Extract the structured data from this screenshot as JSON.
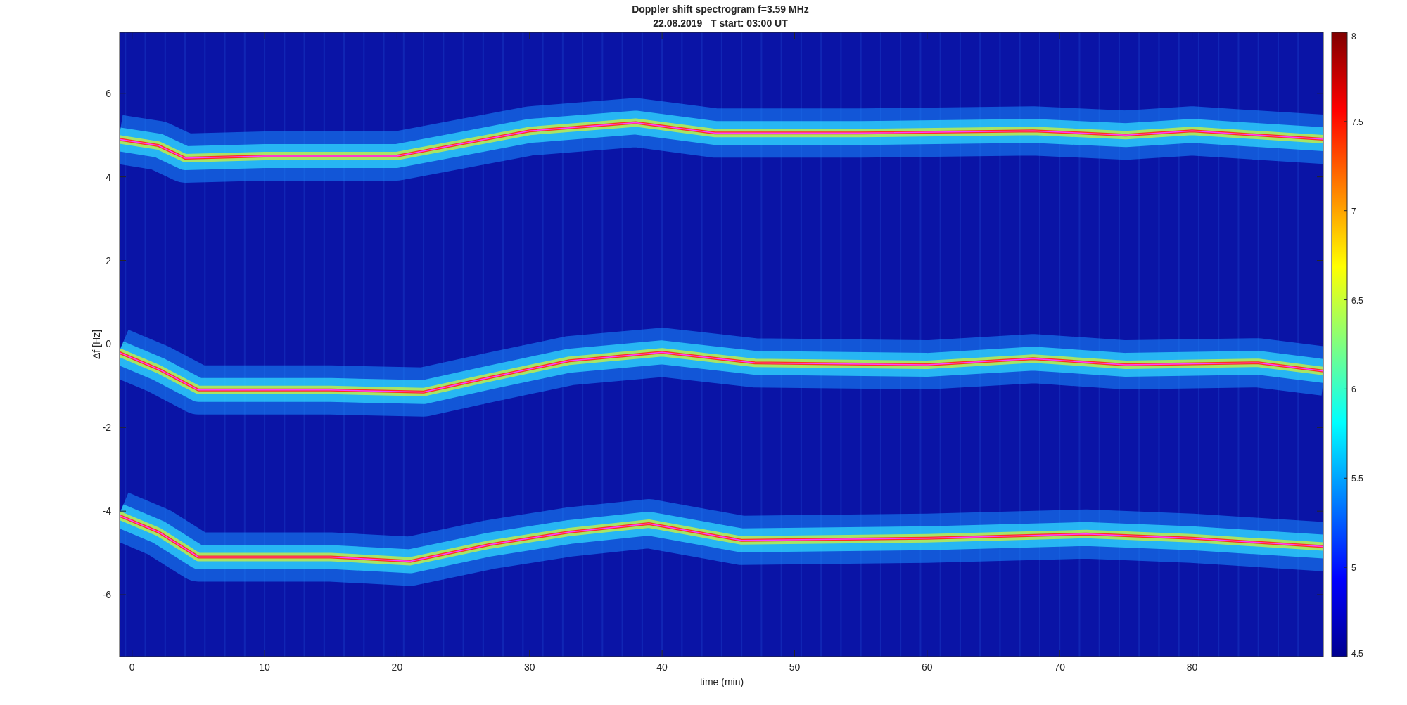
{
  "figure": {
    "title": "Doppler shift spectrogram f=3.59 MHz",
    "subtitle": "22.08.2019   T start: 03:00 UT",
    "xlabel": "time (min)",
    "ylabel": "Δf [Hz]",
    "xticks": [
      "0",
      "10",
      "20",
      "30",
      "40",
      "50",
      "60",
      "70",
      "80"
    ],
    "yticks": [
      "6",
      "4",
      "2",
      "0",
      "-2",
      "-4",
      "-6"
    ],
    "colorbar_ticks": [
      "8",
      "7.5",
      "7",
      "6.5",
      "6",
      "5.5",
      "5",
      "4.5"
    ]
  }
}
